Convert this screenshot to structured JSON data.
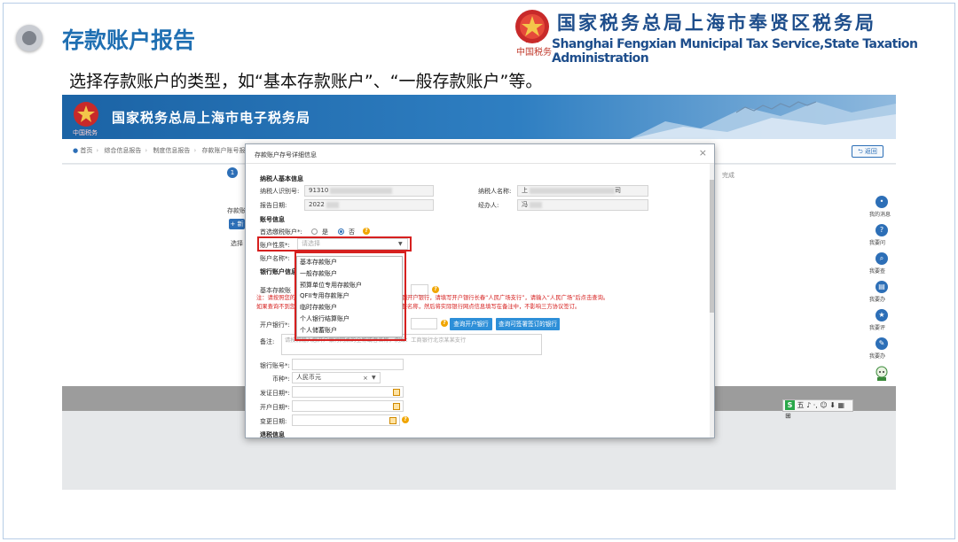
{
  "slide": {
    "title": "存款账户报告",
    "org_cn": "国家税务总局上海市奉贤区税务局",
    "org_en": "Shanghai Fengxian Municipal Tax Service,State Taxation Administration",
    "emblem_script": "中国税务",
    "instruction": "选择存款账户的类型，如“基本存款账户”、“一般存款账户”等。"
  },
  "portal": {
    "banner_title": "国家税务总局上海市电子税务局",
    "breadcrumb": [
      "首页",
      "综合信息报告",
      "制度信息报告",
      "存款账户账号报告"
    ],
    "back_label": "返回",
    "step_number": "1",
    "step_tail": "完成",
    "under_labels": {
      "account_report": "存款账",
      "list_header": "选择"
    },
    "add_label": "+ 新",
    "sidebar_tools": [
      {
        "icon": "chat-icon",
        "glyph": "•",
        "label": "我的消息"
      },
      {
        "icon": "question-icon",
        "glyph": "?",
        "label": "我要问"
      },
      {
        "icon": "search-icon",
        "glyph": "⌕",
        "label": "我要查"
      },
      {
        "icon": "document-icon",
        "glyph": "▤",
        "label": "我要办"
      },
      {
        "icon": "star-icon",
        "glyph": "★",
        "label": "我要评"
      },
      {
        "icon": "edit-icon",
        "glyph": "✎",
        "label": "我要办"
      }
    ],
    "ime_text": "五 ♪ ·, ☺ ⬇ ▦ ⊞"
  },
  "modal": {
    "title": "存款账户存号详细信息",
    "close_glyph": "×",
    "section_taxpayer": "纳税人基本信息",
    "taxpayer_id_label": "纳税人识别号:",
    "taxpayer_id_value": "91310",
    "taxpayer_name_label": "纳税人名称:",
    "taxpayer_name_prefix": "上",
    "taxpayer_name_suffix": "司",
    "report_date_label": "报告日期:",
    "report_date_value": "2022",
    "handler_label": "经办人:",
    "handler_value": "冯",
    "section_account": "账号信息",
    "primary_label": "首选缴税账户*:",
    "radio_yes": "是",
    "radio_no": "否",
    "nature_label": "账户性质*:",
    "nature_placeholder": "请选择",
    "name_label": "账户名称*:",
    "section_bank": "银行账户信息",
    "basic_label": "基本存款账",
    "notice_text": "注：请按照您的开户许可证或开户银行的信息填写，如找不到开户银行，请填写开户银行长春“人民广场支行”，请输入“人民广场”后点击查询。如果查询不到您的开户银行，请在备注中填写开户银行的完整名称，然后将实际银行网点信息填写在备注中，不影响三方协议签订。",
    "bank_label": "开户银行*:",
    "btn_query_bank": "查询开户银行",
    "btn_query_tripartite": "查询可签署签订的银行",
    "remark_label": "备注:",
    "remark_placeholder": "请按照输入您开户银行网点的全称或者名称，例如：工商银行北京某某支行",
    "bank_acct_label": "银行账号*:",
    "currency_label": "币种*:",
    "currency_value": "人民币元",
    "currency_clear": "×",
    "issue_date_label": "发证日期*:",
    "open_date_label": "开户日期*:",
    "change_date_label": "变更日期:",
    "section_tax": "退税信息"
  },
  "dropdown": {
    "options": [
      "基本存款账户",
      "一般存款账户",
      "预算单位专用存款账户",
      "QFII专用存款账户",
      "临时存款账户",
      "个人银行结算账户",
      "个人储蓄账户"
    ]
  },
  "colors": {
    "accent": "#1f6fb2",
    "highlight": "#d6201f",
    "primary_button": "#2d8fd8"
  }
}
